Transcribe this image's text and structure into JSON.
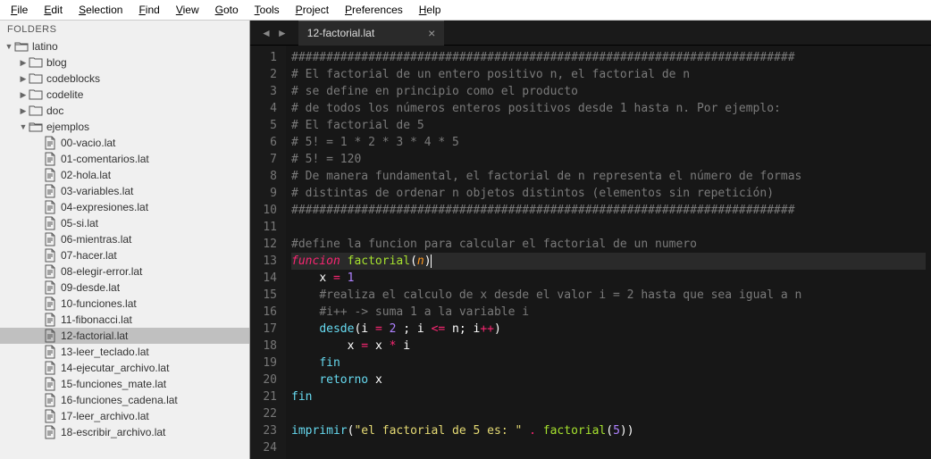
{
  "menu": [
    "File",
    "Edit",
    "Selection",
    "Find",
    "View",
    "Goto",
    "Tools",
    "Project",
    "Preferences",
    "Help"
  ],
  "sidebar": {
    "title": "FOLDERS",
    "tree": [
      {
        "level": 0,
        "type": "folder",
        "open": true,
        "label": "latino"
      },
      {
        "level": 1,
        "type": "folder",
        "open": false,
        "label": "blog"
      },
      {
        "level": 1,
        "type": "folder",
        "open": false,
        "label": "codeblocks"
      },
      {
        "level": 1,
        "type": "folder",
        "open": false,
        "label": "codelite"
      },
      {
        "level": 1,
        "type": "folder",
        "open": false,
        "label": "doc"
      },
      {
        "level": 1,
        "type": "folder",
        "open": true,
        "label": "ejemplos"
      },
      {
        "level": 2,
        "type": "file",
        "label": "00-vacio.lat"
      },
      {
        "level": 2,
        "type": "file",
        "label": "01-comentarios.lat"
      },
      {
        "level": 2,
        "type": "file",
        "label": "02-hola.lat"
      },
      {
        "level": 2,
        "type": "file",
        "label": "03-variables.lat"
      },
      {
        "level": 2,
        "type": "file",
        "label": "04-expresiones.lat"
      },
      {
        "level": 2,
        "type": "file",
        "label": "05-si.lat"
      },
      {
        "level": 2,
        "type": "file",
        "label": "06-mientras.lat"
      },
      {
        "level": 2,
        "type": "file",
        "label": "07-hacer.lat"
      },
      {
        "level": 2,
        "type": "file",
        "label": "08-elegir-error.lat"
      },
      {
        "level": 2,
        "type": "file",
        "label": "09-desde.lat"
      },
      {
        "level": 2,
        "type": "file",
        "label": "10-funciones.lat"
      },
      {
        "level": 2,
        "type": "file",
        "label": "11-fibonacci.lat"
      },
      {
        "level": 2,
        "type": "file",
        "label": "12-factorial.lat",
        "selected": true
      },
      {
        "level": 2,
        "type": "file",
        "label": "13-leer_teclado.lat"
      },
      {
        "level": 2,
        "type": "file",
        "label": "14-ejecutar_archivo.lat"
      },
      {
        "level": 2,
        "type": "file",
        "label": "15-funciones_mate.lat"
      },
      {
        "level": 2,
        "type": "file",
        "label": "16-funciones_cadena.lat"
      },
      {
        "level": 2,
        "type": "file",
        "label": "17-leer_archivo.lat"
      },
      {
        "level": 2,
        "type": "file",
        "label": "18-escribir_archivo.lat"
      }
    ]
  },
  "tab": {
    "title": "12-factorial.lat"
  },
  "code": {
    "lines": [
      {
        "n": 1,
        "t": "comment",
        "txt": "########################################################################"
      },
      {
        "n": 2,
        "t": "comment",
        "txt": "# El factorial de un entero positivo n, el factorial de n"
      },
      {
        "n": 3,
        "t": "comment",
        "txt": "# se define en principio como el producto"
      },
      {
        "n": 4,
        "t": "comment",
        "txt": "# de todos los números enteros positivos desde 1 hasta n. Por ejemplo:"
      },
      {
        "n": 5,
        "t": "comment",
        "txt": "# El factorial de 5"
      },
      {
        "n": 6,
        "t": "comment",
        "txt": "# 5! = 1 * 2 * 3 * 4 * 5"
      },
      {
        "n": 7,
        "t": "comment",
        "txt": "# 5! = 120"
      },
      {
        "n": 8,
        "t": "comment",
        "txt": "# De manera fundamental, el factorial de n representa el número de formas"
      },
      {
        "n": 9,
        "t": "comment",
        "txt": "# distintas de ordenar n objetos distintos (elementos sin repetición)"
      },
      {
        "n": 10,
        "t": "comment",
        "txt": "########################################################################"
      },
      {
        "n": 11,
        "t": "blank",
        "txt": ""
      },
      {
        "n": 12,
        "t": "comment",
        "txt": "#define la funcion para calcular el factorial de un numero"
      },
      {
        "n": 13,
        "t": "funcdef",
        "hl": true
      },
      {
        "n": 14,
        "t": "assign_x1"
      },
      {
        "n": 15,
        "t": "comment",
        "indent": 1,
        "txt": "#realiza el calculo de x desde el valor i = 2 hasta que sea igual a n"
      },
      {
        "n": 16,
        "t": "comment",
        "indent": 1,
        "txt": "#i++ -> suma 1 a la variable i"
      },
      {
        "n": 17,
        "t": "desde"
      },
      {
        "n": 18,
        "t": "mult"
      },
      {
        "n": 19,
        "t": "fin",
        "indent": 1
      },
      {
        "n": 20,
        "t": "retorno"
      },
      {
        "n": 21,
        "t": "fin",
        "indent": 0
      },
      {
        "n": 22,
        "t": "blank",
        "txt": ""
      },
      {
        "n": 23,
        "t": "imprimir"
      },
      {
        "n": 24,
        "t": "blank",
        "txt": ""
      }
    ],
    "tokens": {
      "funcion": "funcion",
      "factorial": "factorial",
      "n": "n",
      "x": "x",
      "i": "i",
      "one": "1",
      "two": "2",
      "five": "5",
      "desde": "desde",
      "fin": "fin",
      "retorno": "retorno",
      "imprimir": "imprimir",
      "str": "\"el factorial de 5 es: \""
    }
  }
}
